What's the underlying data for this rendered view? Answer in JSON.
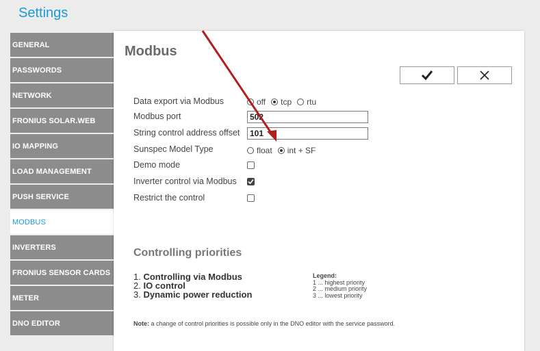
{
  "app": {
    "title": "Settings"
  },
  "sidebar": {
    "items": [
      {
        "label": "GENERAL"
      },
      {
        "label": "PASSWORDS"
      },
      {
        "label": "NETWORK"
      },
      {
        "label": "FRONIUS SOLAR.WEB"
      },
      {
        "label": "IO MAPPING"
      },
      {
        "label": "LOAD MANAGEMENT"
      },
      {
        "label": "PUSH SERVICE"
      },
      {
        "label": "MODBUS",
        "active": true
      },
      {
        "label": "INVERTERS"
      },
      {
        "label": "FRONIUS SENSOR CARDS"
      },
      {
        "label": "METER"
      },
      {
        "label": "DNO EDITOR"
      }
    ]
  },
  "panel": {
    "title": "Modbus",
    "ok_icon": "checkmark-icon",
    "cancel_icon": "close-icon"
  },
  "form": {
    "data_export": {
      "label": "Data export via Modbus",
      "options": [
        "off",
        "tcp",
        "rtu"
      ],
      "selected": "tcp"
    },
    "modbus_port": {
      "label": "Modbus port",
      "value": "502"
    },
    "string_offset": {
      "label": "String control address offset",
      "value": "101"
    },
    "sunspec": {
      "label": "Sunspec Model Type",
      "options": [
        "float",
        "int + SF"
      ],
      "selected": "int + SF"
    },
    "demo_mode": {
      "label": "Demo mode",
      "checked": false
    },
    "inverter_control": {
      "label": "Inverter control via Modbus",
      "checked": true
    },
    "restrict_control": {
      "label": "Restrict the control",
      "checked": false
    }
  },
  "priorities": {
    "title": "Controlling priorities",
    "items": [
      {
        "num": "1.",
        "text": "Controlling via Modbus",
        "bold": true
      },
      {
        "num": "2.",
        "text": "IO control",
        "bold": true
      },
      {
        "num": "3.",
        "text": "Dynamic power reduction",
        "bold": true
      }
    ],
    "legend": {
      "title": "Legend:",
      "lines": [
        "1 ... highest priority",
        "2 ... medium priority",
        "3 ... lowest priority"
      ]
    },
    "note_bold": "Note:",
    "note_text": " a change of control priorities is possible only in the DNO editor with the service password."
  },
  "colors": {
    "accent": "#1a9ad6",
    "sidebar_bg": "#8c8c8c",
    "arrow": "#b01e1e"
  }
}
